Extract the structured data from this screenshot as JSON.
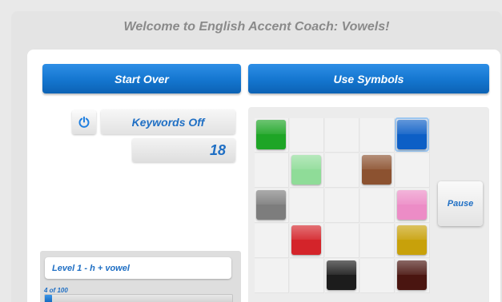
{
  "header": {
    "title": "Welcome to English Accent Coach: Vowels!"
  },
  "toolbar": {
    "start_over_label": "Start Over",
    "use_symbols_label": "Use Symbols"
  },
  "controls": {
    "power_icon": "power-icon",
    "keywords_label": "Keywords Off",
    "counter_value": "18"
  },
  "level": {
    "label": "Level 1 - h + vowel",
    "progress_text": "4 of 100",
    "progress_fraction": 0.04
  },
  "grid": {
    "rows": 5,
    "cols": 5,
    "tiles": [
      {
        "row": 0,
        "col": 0,
        "color": "#1ea526",
        "selected": false
      },
      {
        "row": 0,
        "col": 4,
        "color": "#0d5fc6",
        "selected": true
      },
      {
        "row": 1,
        "col": 1,
        "color": "#8fdc98",
        "selected": false
      },
      {
        "row": 1,
        "col": 3,
        "color": "#8c5230",
        "selected": false
      },
      {
        "row": 2,
        "col": 0,
        "color": "#7d7d7d",
        "selected": false
      },
      {
        "row": 2,
        "col": 4,
        "color": "#ec8cc6",
        "selected": false
      },
      {
        "row": 3,
        "col": 1,
        "color": "#d4242a",
        "selected": false
      },
      {
        "row": 3,
        "col": 4,
        "color": "#c8a10a",
        "selected": false
      },
      {
        "row": 4,
        "col": 2,
        "color": "#1c1c1c",
        "selected": false
      },
      {
        "row": 4,
        "col": 4,
        "color": "#4a1510",
        "selected": false
      }
    ],
    "pause_label": "Pause"
  },
  "colors": {
    "accent_blue": "#1476cf",
    "text_blue": "#1f6fc4"
  }
}
